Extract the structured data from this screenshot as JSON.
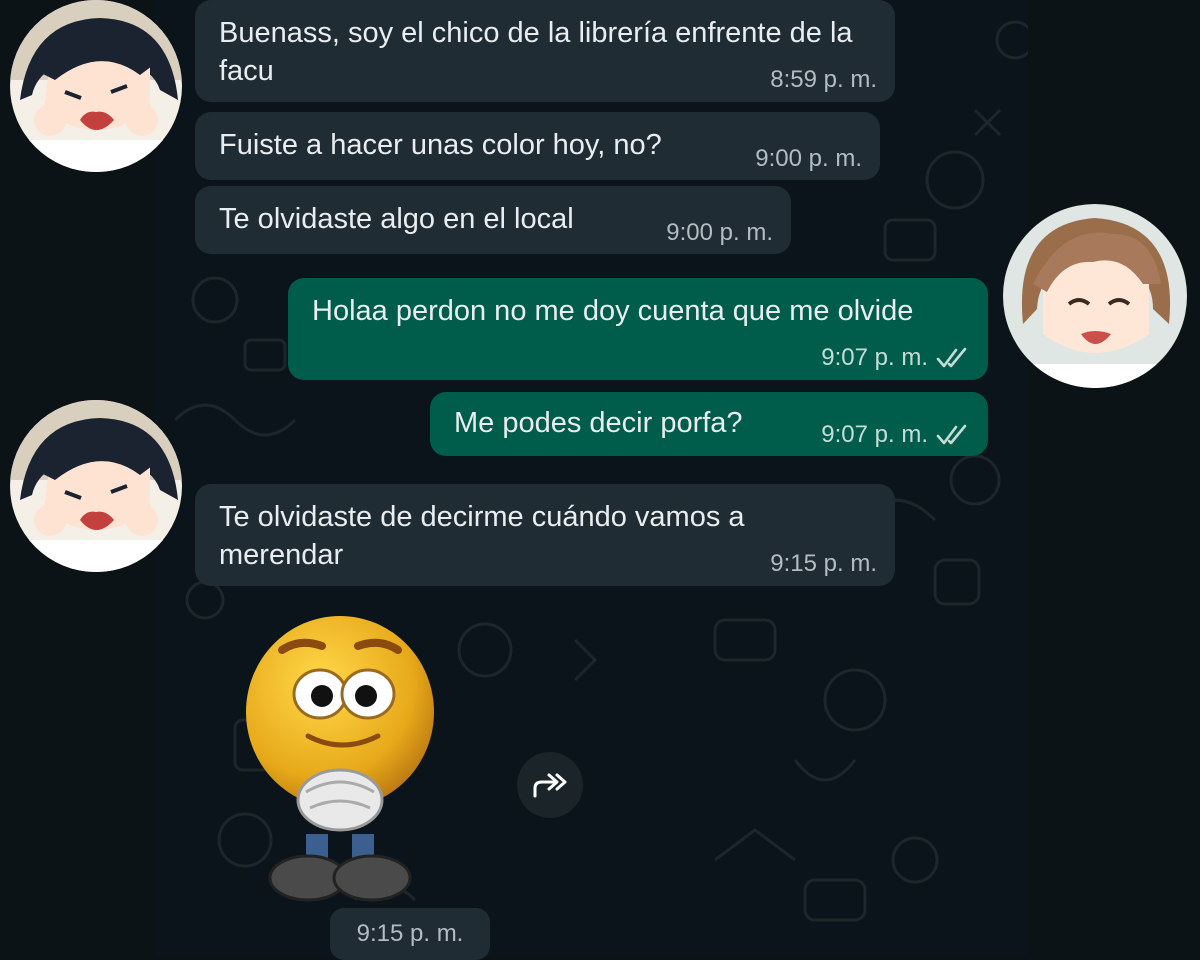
{
  "messages": [
    {
      "text": "Buenass, soy el chico de la librería enfrente de la facu",
      "time": "8:59 p. m."
    },
    {
      "text": "Fuiste a hacer unas color hoy, no?",
      "time": "9:00 p. m."
    },
    {
      "text": "Te olvidaste algo en el local",
      "time": "9:00 p. m."
    },
    {
      "text": "Holaa perdon no me doy cuenta que me olvide",
      "time": "9:07 p. m."
    },
    {
      "text": "Me podes decir porfa?",
      "time": "9:07 p. m."
    },
    {
      "text": "Te olvidaste de decirme cuándo vamos a merendar",
      "time": "9:15 p. m."
    }
  ],
  "sticker": {
    "time": "9:15 p. m."
  },
  "colors": {
    "background": "#0b141a",
    "incoming_bubble": "#1f2c33",
    "outgoing_bubble": "#005c4b",
    "read_ticks": "#c6ddd7"
  },
  "icons": [
    "double-check-icon",
    "forward-icon"
  ]
}
